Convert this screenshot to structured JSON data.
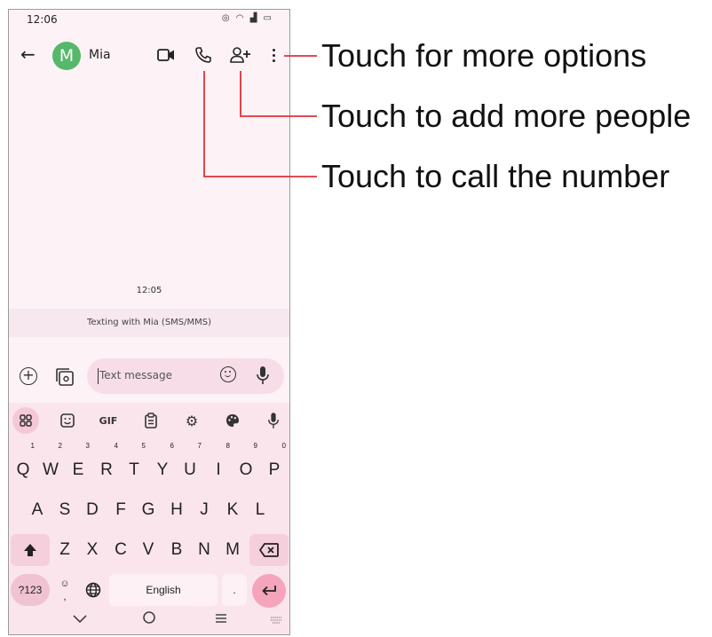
{
  "status_bar": {
    "time": "12:06",
    "icons": [
      "mute-icon",
      "wifi-icon",
      "signal-icon",
      "battery-icon"
    ]
  },
  "app_bar": {
    "contact_initial": "M",
    "contact_name": "Mia",
    "avatar_color": "#55b86a"
  },
  "conversation": {
    "timestamp": "12:05",
    "banner": "Texting with Mia (SMS/MMS)"
  },
  "compose": {
    "placeholder": "Text message"
  },
  "keyboard_toolbar": {
    "gif_label": "GIF"
  },
  "keyboard": {
    "row1": [
      {
        "key": "Q",
        "hint": "1"
      },
      {
        "key": "W",
        "hint": "2"
      },
      {
        "key": "E",
        "hint": "3"
      },
      {
        "key": "R",
        "hint": "4"
      },
      {
        "key": "T",
        "hint": "5"
      },
      {
        "key": "Y",
        "hint": "6"
      },
      {
        "key": "U",
        "hint": "7"
      },
      {
        "key": "I",
        "hint": "8"
      },
      {
        "key": "O",
        "hint": "9"
      },
      {
        "key": "P",
        "hint": "0"
      }
    ],
    "row2": [
      "A",
      "S",
      "D",
      "F",
      "G",
      "H",
      "J",
      "K",
      "L"
    ],
    "row3": [
      "Z",
      "X",
      "C",
      "V",
      "B",
      "N",
      "M"
    ],
    "symbols_label": "?123",
    "comma_label": ",",
    "space_label": "English",
    "period_label": "."
  },
  "annotations": {
    "more_options": "Touch for more options",
    "add_people": "Touch to add more people",
    "call": "Touch to call the number"
  },
  "colors": {
    "accent_line": "#e0303a",
    "keyboard_bg": "#fbe5ec",
    "enter_key": "#f4a5bb"
  }
}
